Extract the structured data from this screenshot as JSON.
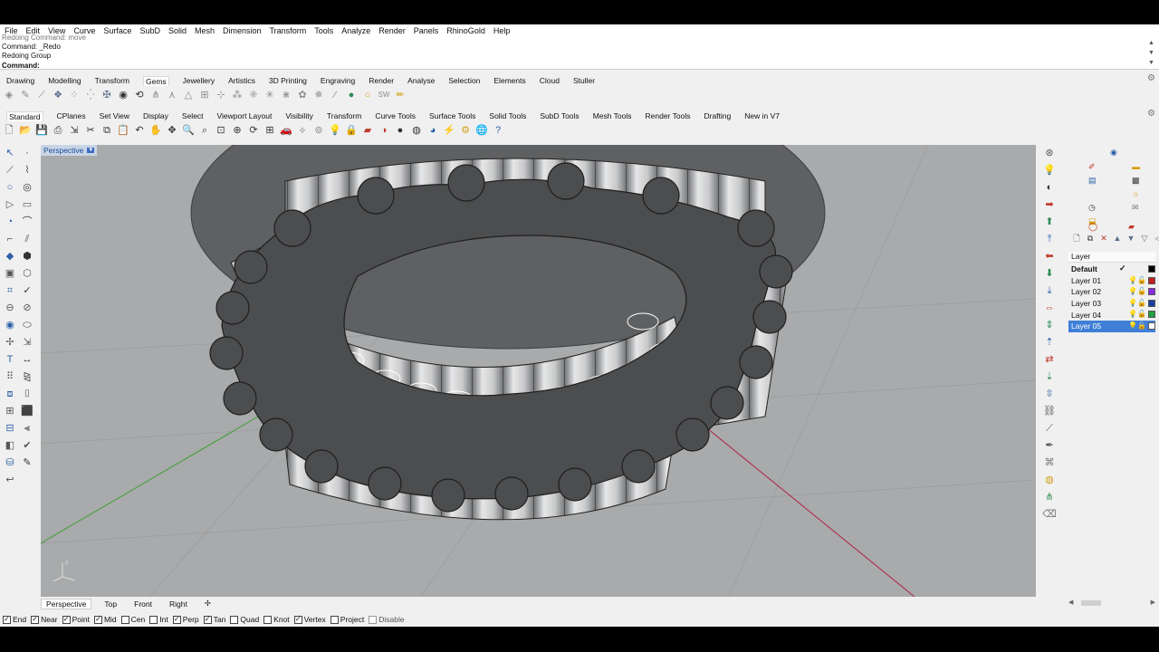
{
  "menubar": [
    "File",
    "Edit",
    "View",
    "Curve",
    "Surface",
    "SubD",
    "Solid",
    "Mesh",
    "Dimension",
    "Transform",
    "Tools",
    "Analyze",
    "Render",
    "Panels",
    "RhinoGold",
    "Help"
  ],
  "command": {
    "history": [
      "Redoing Command: move",
      "Command: _Redo",
      "Redoing Group"
    ],
    "prompt": "Command:",
    "value": ""
  },
  "tabs_rhinogold": [
    "Drawing",
    "Modelling",
    "Transform",
    "Gems",
    "Jewellery",
    "Artistics",
    "3D Printing",
    "Engraving",
    "Render",
    "Analyse",
    "Selection",
    "Elements",
    "Cloud",
    "Stuller"
  ],
  "tabs_rhinogold_active": "Gems",
  "tabs_rhino": [
    "Standard",
    "CPlanes",
    "Set View",
    "Display",
    "Select",
    "Viewport Layout",
    "Visibility",
    "Transform",
    "Curve Tools",
    "Surface Tools",
    "Solid Tools",
    "SubD Tools",
    "Mesh Tools",
    "Render Tools",
    "Drafting",
    "New in V7"
  ],
  "tabs_rhino_active": "Standard",
  "gems_icons": [
    {
      "name": "gem-cutter-icon",
      "glyph": "◈",
      "cls": "g2"
    },
    {
      "name": "gem-studio-icon",
      "glyph": "✎",
      "cls": "g2"
    },
    {
      "name": "pave-icon",
      "glyph": "⟋",
      "cls": "g2"
    },
    {
      "name": "gem-set-icon",
      "glyph": "❖",
      "cls": "g1"
    },
    {
      "name": "gems-by-curve-icon",
      "glyph": "⁘",
      "cls": "g2"
    },
    {
      "name": "gems-by-uv-icon",
      "glyph": "⁛",
      "cls": "g2"
    },
    {
      "name": "prong-icon",
      "glyph": "✠",
      "cls": "g1"
    },
    {
      "name": "bezel-icon",
      "glyph": "◉",
      "cls": "g7"
    },
    {
      "name": "rotate-gem-icon",
      "glyph": "⟲",
      "cls": "g7"
    },
    {
      "name": "cutter-icon",
      "glyph": "⋔",
      "cls": "g2"
    },
    {
      "name": "cutter-line-icon",
      "glyph": "⋏",
      "cls": "g2"
    },
    {
      "name": "triangle-set-icon",
      "glyph": "△",
      "cls": "g2"
    },
    {
      "name": "gem-grid-icon",
      "glyph": "⊞",
      "cls": "g2"
    },
    {
      "name": "gem-move-icon",
      "glyph": "⊹",
      "cls": "g2"
    },
    {
      "name": "gem-cluster-icon",
      "glyph": "⁂",
      "cls": "g2"
    },
    {
      "name": "gem-pattern-icon",
      "glyph": "⁜",
      "cls": "g2"
    },
    {
      "name": "gem-spread-icon",
      "glyph": "✳",
      "cls": "g2"
    },
    {
      "name": "gem-array-icon",
      "glyph": "⋇",
      "cls": "g2"
    },
    {
      "name": "gem-flower-icon",
      "glyph": "✿",
      "cls": "g2"
    },
    {
      "name": "gem-star-icon",
      "glyph": "✵",
      "cls": "g2"
    },
    {
      "name": "gem-wand-icon",
      "glyph": "⁄",
      "cls": "g2"
    },
    {
      "name": "gem-sphere-icon",
      "glyph": "●",
      "cls": "g5"
    },
    {
      "name": "gem-pearl-icon",
      "glyph": "○",
      "cls": "g6"
    },
    {
      "name": "gem-sw-icon",
      "glyph": "SW",
      "cls": "g2"
    },
    {
      "name": "gem-pencil-icon",
      "glyph": "✏",
      "cls": "g6"
    }
  ],
  "standard_icons": [
    {
      "name": "new-file-icon",
      "glyph": "🗋",
      "cls": "g7"
    },
    {
      "name": "open-file-icon",
      "glyph": "📂",
      "cls": "g6"
    },
    {
      "name": "save-icon",
      "glyph": "💾",
      "cls": "g7"
    },
    {
      "name": "print-icon",
      "glyph": "⎙",
      "cls": "g7"
    },
    {
      "name": "import-icon",
      "glyph": "⇲",
      "cls": "g7"
    },
    {
      "name": "cut-icon",
      "glyph": "✂",
      "cls": "g7"
    },
    {
      "name": "copy-icon",
      "glyph": "⧉",
      "cls": "g7"
    },
    {
      "name": "paste-icon",
      "glyph": "📋",
      "cls": "g6"
    },
    {
      "name": "undo-icon",
      "glyph": "↶",
      "cls": "g7"
    },
    {
      "name": "pan-icon",
      "glyph": "✋",
      "cls": "g7"
    },
    {
      "name": "move-view-icon",
      "glyph": "✥",
      "cls": "g7"
    },
    {
      "name": "zoom-icon",
      "glyph": "🔍",
      "cls": "g7"
    },
    {
      "name": "zoom-window-icon",
      "glyph": "⌕",
      "cls": "g7"
    },
    {
      "name": "zoom-extents-icon",
      "glyph": "⊡",
      "cls": "g7"
    },
    {
      "name": "zoom-selected-icon",
      "glyph": "⊕",
      "cls": "g7"
    },
    {
      "name": "rotate-view-icon",
      "glyph": "⟳",
      "cls": "g7"
    },
    {
      "name": "four-view-icon",
      "glyph": "⊞",
      "cls": "g7"
    },
    {
      "name": "car-icon",
      "glyph": "🚗",
      "cls": "g4"
    },
    {
      "name": "cplane-icon",
      "glyph": "⟡",
      "cls": "g2"
    },
    {
      "name": "osnap-icon",
      "glyph": "⊚",
      "cls": "g2"
    },
    {
      "name": "light-icon",
      "glyph": "💡",
      "cls": "g2"
    },
    {
      "name": "lock-icon",
      "glyph": "🔒",
      "cls": "g7"
    },
    {
      "name": "layers-icon",
      "glyph": "▰",
      "cls": "g4"
    },
    {
      "name": "color-wheel-icon",
      "glyph": "◑",
      "cls": "g4"
    },
    {
      "name": "sphere-icon",
      "glyph": "●",
      "cls": "g7"
    },
    {
      "name": "render-sphere-icon",
      "glyph": "◍",
      "cls": "g7"
    },
    {
      "name": "globe-icon",
      "glyph": "◕",
      "cls": "g3"
    },
    {
      "name": "lightning-icon",
      "glyph": "⚡",
      "cls": "g6"
    },
    {
      "name": "gear-options-icon",
      "glyph": "⚙",
      "cls": "g6"
    },
    {
      "name": "earth-icon",
      "glyph": "🌐",
      "cls": "g5"
    },
    {
      "name": "help-icon",
      "glyph": "?",
      "cls": "g3"
    }
  ],
  "left_tools": [
    {
      "name": "select-icon",
      "glyph": "↖"
    },
    {
      "name": "point-icon",
      "glyph": "·"
    },
    {
      "name": "polyline-icon",
      "glyph": "⟋"
    },
    {
      "name": "curve-icon",
      "glyph": "⌇"
    },
    {
      "name": "circle-icon",
      "glyph": "○"
    },
    {
      "name": "ellipse-icon",
      "glyph": "◎"
    },
    {
      "name": "polygon-icon",
      "glyph": "▷"
    },
    {
      "name": "rectangle-icon",
      "glyph": "▭"
    },
    {
      "name": "arc-icon",
      "glyph": "◔"
    },
    {
      "name": "freeform-icon",
      "glyph": "⌒"
    },
    {
      "name": "fillet-icon",
      "glyph": "⌐"
    },
    {
      "name": "offset-icon",
      "glyph": "⫽"
    },
    {
      "name": "surface-icon",
      "glyph": "◆"
    },
    {
      "name": "extrude-icon",
      "glyph": "⬢"
    },
    {
      "name": "box-icon",
      "glyph": "▣"
    },
    {
      "name": "loft-icon",
      "glyph": "⬡"
    },
    {
      "name": "mesh-icon",
      "glyph": "⌗"
    },
    {
      "name": "shell-icon",
      "glyph": "✓"
    },
    {
      "name": "boolean-icon",
      "glyph": "⊖"
    },
    {
      "name": "split-icon",
      "glyph": "⊘"
    },
    {
      "name": "sphere-tool-icon",
      "glyph": "◉"
    },
    {
      "name": "cylinder-icon",
      "glyph": "⬭"
    },
    {
      "name": "move-tool-icon",
      "glyph": "✢"
    },
    {
      "name": "scale-tool-icon",
      "glyph": "⇲"
    },
    {
      "name": "text-tool-icon",
      "glyph": "T"
    },
    {
      "name": "dimension-icon",
      "glyph": "↔"
    },
    {
      "name": "array-icon",
      "glyph": "⠿"
    },
    {
      "name": "mirror-icon",
      "glyph": "⧎"
    },
    {
      "name": "group-icon",
      "glyph": "⧈"
    },
    {
      "name": "block-icon",
      "glyph": "⌷"
    },
    {
      "name": "grid-tool-icon",
      "glyph": "⊞"
    },
    {
      "name": "render-tool-icon",
      "glyph": "⬛"
    },
    {
      "name": "sweep-icon",
      "glyph": "⊟"
    },
    {
      "name": "edit-pts-icon",
      "glyph": "⫷"
    },
    {
      "name": "analyze-icon",
      "glyph": "◧"
    },
    {
      "name": "check-tool-icon",
      "glyph": "✔"
    },
    {
      "name": "paint-icon",
      "glyph": "⛁"
    },
    {
      "name": "pencil-tool-icon",
      "glyph": "✎"
    },
    {
      "name": "hook-tool-icon",
      "glyph": "↩"
    },
    {
      "name": "blank-icon",
      "glyph": ""
    }
  ],
  "viewport": {
    "title": "Perspective",
    "axis_label": "z"
  },
  "right_tools": [
    {
      "name": "gumball-icon",
      "glyph": "⊛"
    },
    {
      "name": "light-bulb-icon",
      "glyph": "💡"
    },
    {
      "name": "render-view-icon",
      "glyph": "◐"
    },
    {
      "name": "arrow-right-icon",
      "glyph": "➡"
    },
    {
      "name": "arrow-up-icon",
      "glyph": "⬆"
    },
    {
      "name": "move-up-icon",
      "glyph": "⤒"
    },
    {
      "name": "arrow-left-icon",
      "glyph": "⬅"
    },
    {
      "name": "arrow-down-icon",
      "glyph": "⬇"
    },
    {
      "name": "move-down-icon",
      "glyph": "⤓"
    },
    {
      "name": "double-arrow-icon",
      "glyph": "⇔"
    },
    {
      "name": "up-down-icon",
      "glyph": "⇕"
    },
    {
      "name": "align-up-icon",
      "glyph": "⇡"
    },
    {
      "name": "left-right-icon",
      "glyph": "⇄"
    },
    {
      "name": "down-icon",
      "glyph": "⇣"
    },
    {
      "name": "stack-icon",
      "glyph": "⇳"
    },
    {
      "name": "chain-icon",
      "glyph": "⛓"
    },
    {
      "name": "slash-icon",
      "glyph": "⟋"
    },
    {
      "name": "pen-icon",
      "glyph": "✒"
    },
    {
      "name": "tag-icon",
      "glyph": "⌘"
    },
    {
      "name": "compass-icon",
      "glyph": "◍"
    },
    {
      "name": "tree-icon",
      "glyph": "⋔"
    },
    {
      "name": "eraser-icon",
      "glyph": "⌫"
    }
  ],
  "panel_icons": [
    {
      "name": "properties-icon",
      "glyph": "◉",
      "c": "#2b5fa8"
    },
    {
      "name": "brush-icon",
      "glyph": "✐",
      "c": "#c0392b"
    },
    {
      "name": "folder-icon",
      "glyph": "▬",
      "c": "#d4a017"
    },
    {
      "name": "materials-icon",
      "glyph": "▤",
      "c": "#2b5fa8"
    },
    {
      "name": "rw-icon",
      "glyph": "▩",
      "c": "#333"
    },
    {
      "name": "sun-icon",
      "glyph": "☼",
      "c": "#d4a017"
    },
    {
      "name": "clock-icon",
      "glyph": "◷",
      "c": "#333"
    },
    {
      "name": "envelope-icon",
      "glyph": "✉",
      "c": "#777"
    },
    {
      "name": "library-icon",
      "glyph": "⬓",
      "c": "#d4a017"
    },
    {
      "name": "color-circle-icon",
      "glyph": "◯",
      "c": "#c0392b"
    },
    {
      "name": "layer-panel-icon",
      "glyph": "▰",
      "c": "#c0392b"
    }
  ],
  "layer_toolbar": [
    {
      "name": "new-layer-icon",
      "glyph": "🗋",
      "c": "#333"
    },
    {
      "name": "new-sublayer-icon",
      "glyph": "⧉",
      "c": "#333"
    },
    {
      "name": "delete-layer-icon",
      "glyph": "✕",
      "c": "#c0392b"
    },
    {
      "name": "move-layer-up-icon",
      "glyph": "▲",
      "c": "#5a6f8a"
    },
    {
      "name": "move-layer-down-icon",
      "glyph": "▼",
      "c": "#5a6f8a"
    },
    {
      "name": "filter-icon",
      "glyph": "▽",
      "c": "#5a6f8a"
    },
    {
      "name": "collapse-icon",
      "glyph": "◁",
      "c": "#5a6f8a"
    },
    {
      "name": "funnel-icon",
      "glyph": "⧩",
      "c": "#2b5fa8"
    }
  ],
  "layers": {
    "header": "Layer",
    "items": [
      {
        "name": "Default",
        "current": true,
        "color": "#000000",
        "bold": true
      },
      {
        "name": "Layer 01",
        "current": false,
        "color": "#c02020"
      },
      {
        "name": "Layer 02",
        "current": false,
        "color": "#8a2be2"
      },
      {
        "name": "Layer 03",
        "current": false,
        "color": "#1a3fa0"
      },
      {
        "name": "Layer 04",
        "current": false,
        "color": "#22a040"
      },
      {
        "name": "Layer 05",
        "current": false,
        "color": "#ffffff",
        "selected": true
      }
    ],
    "current_mark": "✓"
  },
  "viewport_tabs": [
    "Perspective",
    "Top",
    "Front",
    "Right"
  ],
  "viewport_tabs_active": "Perspective",
  "osnaps": [
    {
      "label": "End",
      "checked": true
    },
    {
      "label": "Near",
      "checked": true
    },
    {
      "label": "Point",
      "checked": true
    },
    {
      "label": "Mid",
      "checked": true
    },
    {
      "label": "Cen",
      "checked": false
    },
    {
      "label": "Int",
      "checked": false
    },
    {
      "label": "Perp",
      "checked": true
    },
    {
      "label": "Tan",
      "checked": true
    },
    {
      "label": "Quad",
      "checked": false
    },
    {
      "label": "Knot",
      "checked": false
    },
    {
      "label": "Vertex",
      "checked": true
    },
    {
      "label": "Project",
      "checked": false
    },
    {
      "label": "Disable",
      "checked": false,
      "disabled": true
    }
  ],
  "colors": {
    "viewport_bg": "#a9aaab",
    "selection": "#3f7fd8",
    "x_axis": "#b02040",
    "y_axis": "#3aa030"
  }
}
